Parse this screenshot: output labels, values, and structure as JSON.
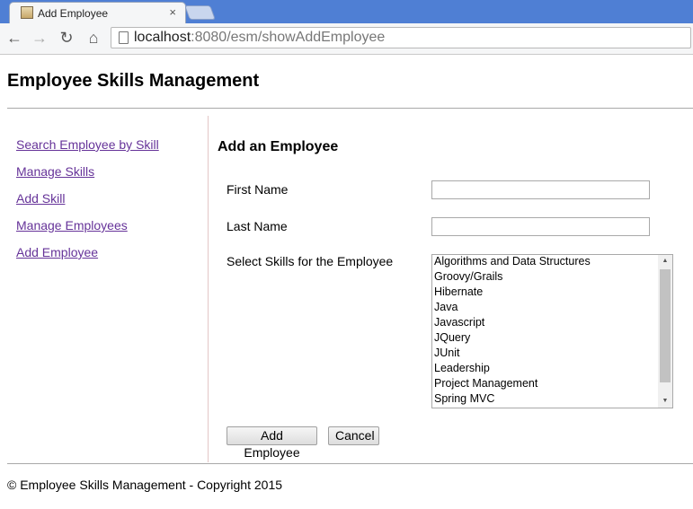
{
  "browser": {
    "tab_title": "Add Employee",
    "tab_close": "×",
    "url_host": "localhost",
    "url_rest": ":8080/esm/showAddEmployee",
    "back_icon": "←",
    "forward_icon": "→",
    "reload_icon": "↻",
    "home_icon": "⌂"
  },
  "header": {
    "title": "Employee Skills Management"
  },
  "sidebar": {
    "items": [
      {
        "label": "Search Employee by Skill"
      },
      {
        "label": "Manage Skills"
      },
      {
        "label": "Add Skill"
      },
      {
        "label": "Manage Employees"
      },
      {
        "label": "Add Employee"
      }
    ]
  },
  "form": {
    "title": "Add an Employee",
    "first_name_label": "First Name",
    "first_name_value": "",
    "last_name_label": "Last Name",
    "last_name_value": "",
    "skills_label": "Select Skills for the Employee",
    "skills": [
      "Algorithms and Data Structures",
      "Groovy/Grails",
      "Hibernate",
      "Java",
      "Javascript",
      "JQuery",
      "JUnit",
      "Leadership",
      "Project Management",
      "Spring MVC"
    ],
    "submit_label": "Add Employee",
    "cancel_label": "Cancel"
  },
  "footer": {
    "text": "© Employee Skills Management - Copyright 2015"
  },
  "colors": {
    "link": "#663399",
    "tabstrip": "#4f7fd4"
  }
}
